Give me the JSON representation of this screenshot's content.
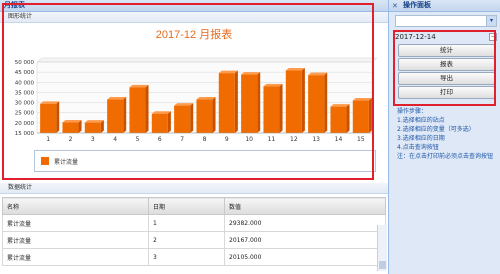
{
  "main": {
    "header": "月报表",
    "chart_panel_label": "图形统计",
    "data_panel_label": "数据统计"
  },
  "chart_data": {
    "type": "bar",
    "title": "2017-12 月报表",
    "categories": [
      "1",
      "2",
      "3",
      "4",
      "5",
      "6",
      "7",
      "8",
      "9",
      "10",
      "11",
      "12",
      "13",
      "14",
      "15"
    ],
    "series": [
      {
        "name": "累计流量",
        "values": [
          29382,
          20167,
          20105,
          31500,
          37500,
          24500,
          28500,
          31500,
          44500,
          43800,
          38000,
          45800,
          43500,
          28000,
          31000
        ]
      }
    ],
    "ylim": [
      15000,
      50000
    ],
    "yticks": [
      "15 000",
      "20 000",
      "25 000",
      "30 000",
      "35 000",
      "40 000",
      "45 000",
      "50 000"
    ],
    "ytick_values": [
      15000,
      20000,
      25000,
      30000,
      35000,
      40000,
      45000,
      50000
    ],
    "color": "#f06c00",
    "legend": "bottom"
  },
  "table": {
    "columns": [
      "名称",
      "日期",
      "数值"
    ],
    "rows": [
      [
        "累计流量",
        "1",
        "29382.000"
      ],
      [
        "累计流量",
        "2",
        "20167.000"
      ],
      [
        "累计流量",
        "3",
        "20105.000"
      ]
    ]
  },
  "side": {
    "header": "操作面板",
    "date": "2017-12-14",
    "collapse": "−",
    "buttons": [
      "统计",
      "报表",
      "导出",
      "打印"
    ],
    "steps": [
      "操作步骤：",
      "1.选择相应的站点",
      "2.选择相应的变量（可多选）",
      "3.选择相应的日期",
      "4.点击查询按钮",
      "注：在点击打印前必须点击查询按钮"
    ]
  },
  "colors": {
    "accent": "#e0202c",
    "bar": "#f06c00",
    "title": "#e56b1f"
  }
}
